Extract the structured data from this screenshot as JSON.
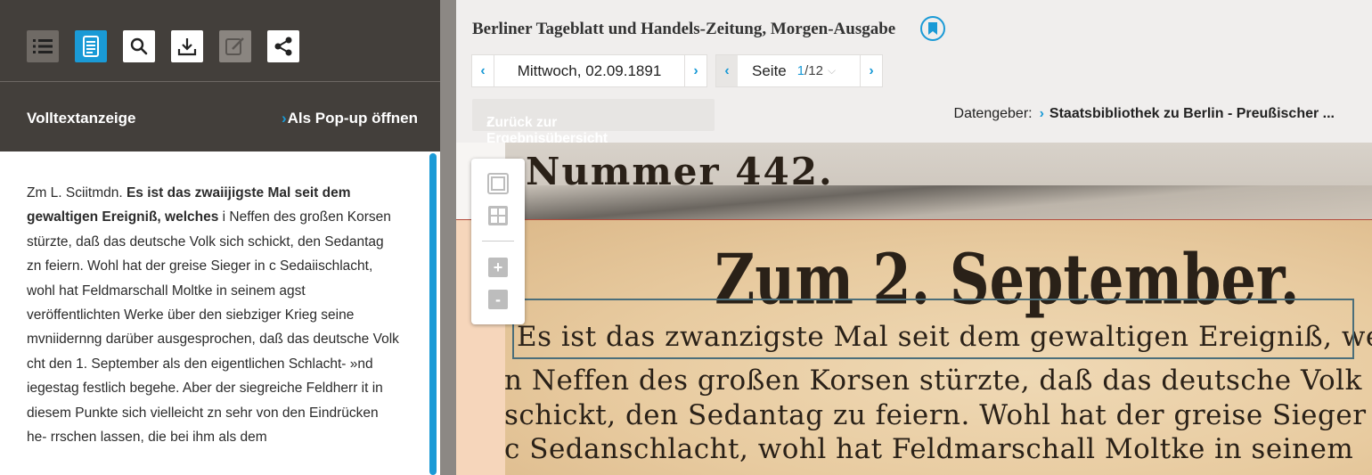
{
  "left_panel": {
    "toolbar": {
      "icons": [
        "list-icon",
        "fulltext-icon",
        "search-icon",
        "download-icon",
        "edit-icon",
        "share-icon"
      ]
    },
    "volltext_title": "Volltextanzeige",
    "popup_label": "Als Pop-up öffnen",
    "fulltext": {
      "plain_start": "Zm L. Sciitmdn. ",
      "bold": "Es ist das zwaiijigste Mal seit dem gewaltigen Ereigniß, welches",
      "rest": " i Neffen des großen Korsen stürzte, daß das deutsche Volk sich schickt, den Sedantag zn feiern. Wohl hat der greise Sieger in c Sedaiischlacht, wohl hat Feldmarschall Moltke in seinem agst veröffentlichten Werke über den siebziger Krieg seine mvniidernng darüber ausgesprochen, daß das deutsche Volk cht den 1. September als den eigentlichen Schlacht- »nd iegestag festlich begehe. Aber der siegreiche Feldherr it in diesem Punkte sich vielleicht zn sehr von den Eindrücken he- rrschen lassen, die bei ihm als dem"
    }
  },
  "right_panel": {
    "publication_title": "Berliner Tageblatt und Handels-Zeitung, Morgen-Ausgabe",
    "date": "Mittwoch, 02.09.1891",
    "page_label": "Seite",
    "page_current": "1",
    "page_total": "/12",
    "back_label": "Zurück zur Ergebnisübersicht",
    "provider_label": "Datengeber:",
    "provider_name": "Staatsbibliothek zu Berlin - Preußischer ...",
    "scan_text": {
      "number": "Nummer 442.",
      "headline": "Zum 2. September.",
      "line1": "Es ist das zwanzigste Mal seit dem gewaltigen Ereigniß, welches",
      "line2": "n Neffen des großen Korsen stürzte, daß das deutsche Volk sich",
      "line3": "schickt, den Sedantag zu feiern. Wohl hat der greise Sieger in",
      "line4": "c Sedanschlacht, wohl hat Feldmarschall Moltke in seinem"
    }
  },
  "colors": {
    "accent": "#1a9ad6",
    "toolbar_bg": "#433f3b"
  }
}
